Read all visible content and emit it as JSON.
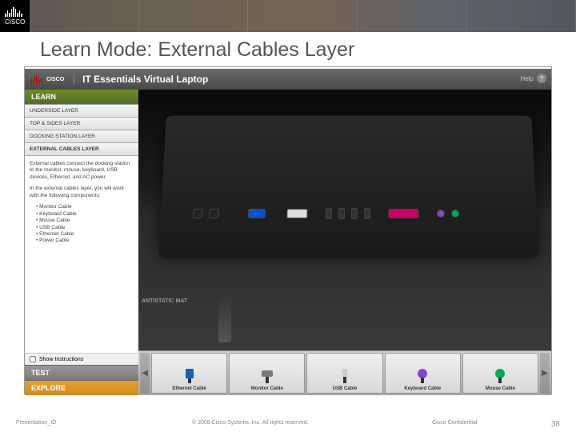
{
  "logo_text": "CISCO",
  "slide_title": "Learn Mode: External Cables Layer",
  "app": {
    "title": "IT Essentials Virtual Laptop",
    "help_text": "Help",
    "nav": {
      "learn": "LEARN",
      "test": "TEST",
      "explore": "EXPLORE",
      "layers": [
        "UNDERSIDE LAYER",
        "TOP & SIDES LAYER",
        "DOCKING STATION LAYER",
        "EXTERNAL CABLES LAYER"
      ]
    },
    "instructions": {
      "p1": "External cables connect the docking station to the monitor, mouse, keyboard, USB devices, Ethernet, and AC power.",
      "p2": "In the external cables layer, you will work with the following components:",
      "components": [
        "Monitor Cable",
        "Keyboard Cable",
        "Mouse Cable",
        "USB Cable",
        "Ethernet Cable",
        "Power Cable"
      ],
      "show_label": "Show Instructions"
    },
    "antistatic": "ANTISTATIC MAT",
    "cables": [
      {
        "name": "Ethernet Cable",
        "color": "#1560bd"
      },
      {
        "name": "Monitor Cable",
        "color": "#7a7a7a"
      },
      {
        "name": "USB Cable",
        "color": "#555555"
      },
      {
        "name": "Keyboard Cable",
        "color": "#8844cc"
      },
      {
        "name": "Mouse Cable",
        "color": "#00aa55"
      }
    ]
  },
  "footer": {
    "id": "Presentation_ID",
    "copyright": "© 2008 Cisco Systems, Inc. All rights reserved.",
    "confidential": "Cisco Confidential",
    "page": "38"
  }
}
